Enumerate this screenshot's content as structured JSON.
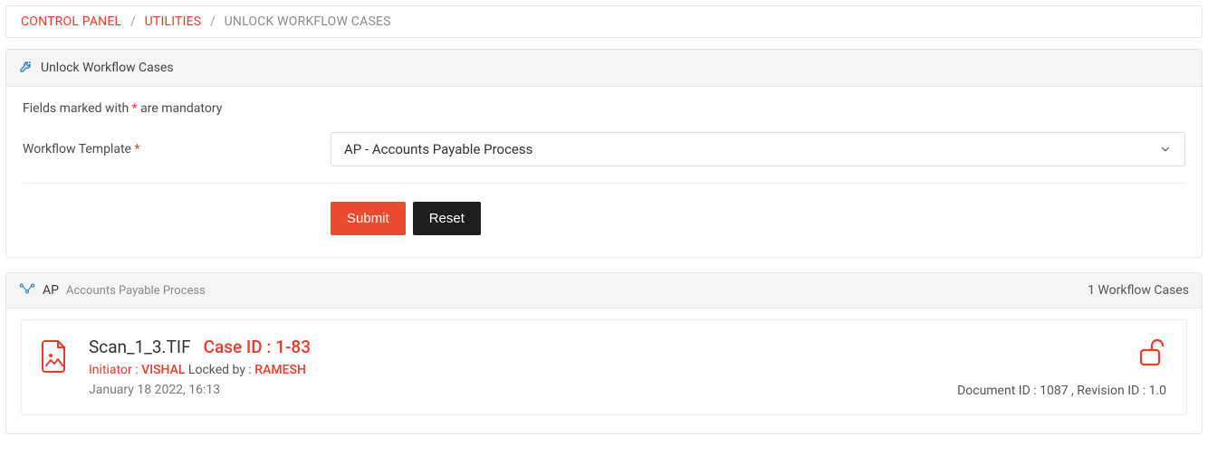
{
  "breadcrumb": {
    "items": [
      {
        "label": "CONTROL PANEL"
      },
      {
        "label": "UTILITIES"
      },
      {
        "label": "UNLOCK WORKFLOW CASES"
      }
    ]
  },
  "panel1": {
    "title": "Unlock Workflow Cases",
    "mandatory_prefix": "Fields marked with ",
    "mandatory_mark": "*",
    "mandatory_suffix": " are mandatory",
    "field_label": "Workflow Template ",
    "field_required_mark": "*",
    "select_value": "AP - Accounts Payable Process",
    "submit_label": "Submit",
    "reset_label": "Reset"
  },
  "panel2": {
    "header_code": "AP",
    "header_sub": "Accounts Payable Process",
    "count_text": "1 Workflow Cases"
  },
  "case": {
    "filename": "Scan_1_3.TIF",
    "case_id_label": "Case ID : 1-83",
    "initiator_label": "Initiator :  ",
    "initiator_value": "VISHAL",
    "locked_by_label": "   Locked by : ",
    "locked_by_value": "RAMESH",
    "timestamp": "January 18 2022, 16:13",
    "doc_rev_text": "Document ID : 1087 , Revision ID : 1.0"
  }
}
